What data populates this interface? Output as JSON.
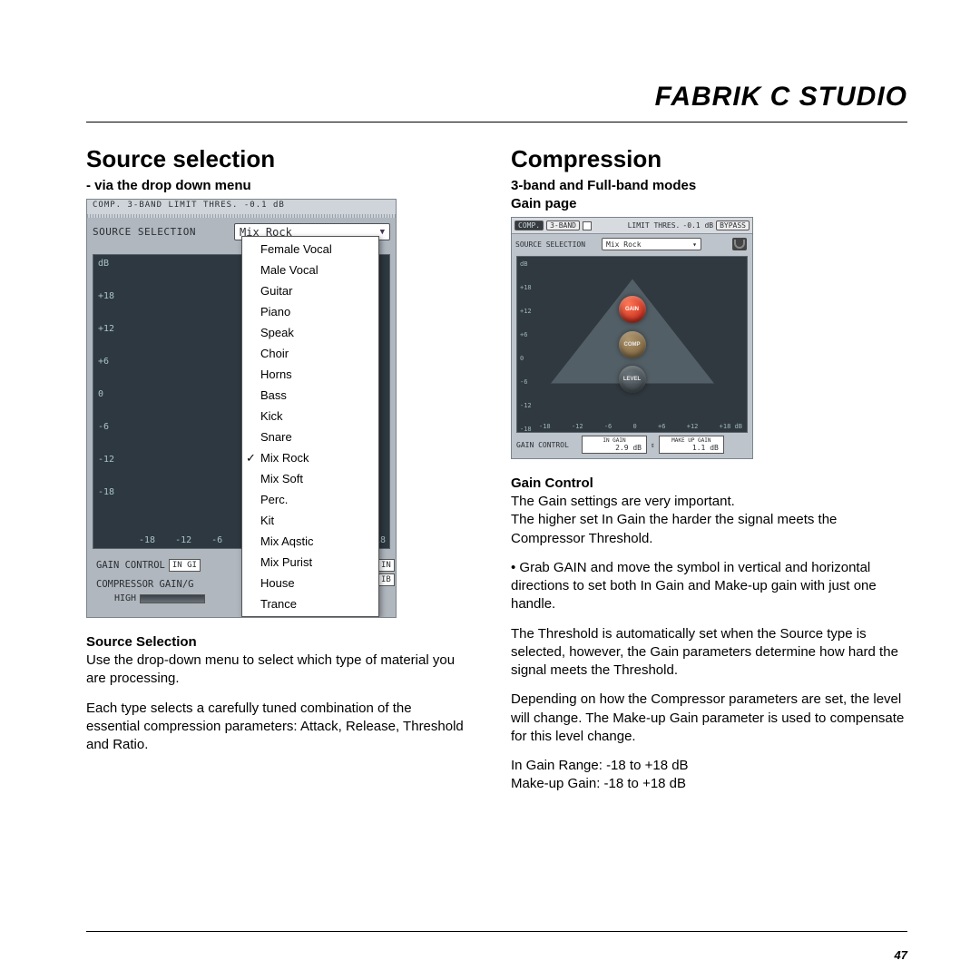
{
  "page_title": "FABRIK C STUDIO",
  "page_number": "47",
  "left": {
    "heading": "Source selection",
    "sub": "- via the drop down menu",
    "shot": {
      "top_strip": "COMP.  3-BAND       LIMIT THRES.  -0.1 dB",
      "src_label": "SOURCE SELECTION",
      "dd_value": "Mix Rock",
      "y_ticks": [
        "dB",
        "+18",
        "+12",
        "+6",
        "0",
        "-6",
        "-12",
        "-18"
      ],
      "x_ticks": [
        "-18",
        "-12",
        "-6"
      ],
      "x_ticks_right": "18",
      "gain_ctrl_label": "GAIN CONTROL",
      "gain_field1": "IN GI",
      "gain_field2_right": "IN",
      "gain_field2b": "IB",
      "comp_row": "COMPRESSOR GAIN/G",
      "high_label": "HIGH",
      "items": [
        "Female Vocal",
        "Male Vocal",
        "Guitar",
        "Piano",
        "Speak",
        "Choir",
        "Horns",
        "Bass",
        "Kick",
        "Snare",
        "Mix Rock",
        "Mix Soft",
        "Perc.",
        "Kit",
        "Mix Aqstic",
        "Mix Purist",
        "House",
        "Trance"
      ],
      "checked": "Mix Rock"
    },
    "body_sub": "Source Selection",
    "body1": "Use the drop-down menu to select which type of material you are processing.",
    "body2": "Each type selects a carefully tuned combination of the essential compression parameters: Attack, Release, Threshold and Ratio."
  },
  "right": {
    "heading": "Compression",
    "sub1": "3-band and Full-band modes",
    "sub2": "Gain page",
    "shot": {
      "comp_label": "COMP.",
      "band_label": "3-BAND",
      "limit_label": "LIMIT THRES.",
      "limit_value": "-0.1 dB",
      "bypass": "BYPASS",
      "src_label": "SOURCE SELECTION",
      "dd_value": "Mix Rock",
      "y2": [
        "dB",
        "+18",
        "+12",
        "+6",
        "0",
        "-6",
        "-12",
        "-18"
      ],
      "x2": [
        "-18",
        "-12",
        "-6",
        "0",
        "+6",
        "+12",
        "+18 dB"
      ],
      "knob_gain": "GAIN",
      "knob_comp": "COMP",
      "knob_level": "LEVEL",
      "gain_ctrl_label": "GAIN CONTROL",
      "in_gain_label": "IN GAIN",
      "in_gain_val": "2.9 dB",
      "makeup_label": "MAKE UP GAIN",
      "makeup_val": "1.1 dB"
    },
    "gc_sub": "Gain Control",
    "gc1": "The Gain settings are very important.",
    "gc2": "The higher set In Gain the harder the signal meets the Compressor Threshold.",
    "gc3": "•   Grab GAIN and move the symbol in vertical and horizontal directions to set both In Gain and Make-up gain with just one handle.",
    "gc4": "The Threshold is automatically set when the Source type is selected, however, the Gain parameters determine how hard the signal meets the Threshold.",
    "gc5": "Depending on how the Compressor parameters are set, the level will change. The Make-up Gain parameter is used to compensate for this level change.",
    "gc6": "In Gain Range: -18 to +18 dB",
    "gc7": "Make-up Gain: -18 to +18 dB"
  }
}
